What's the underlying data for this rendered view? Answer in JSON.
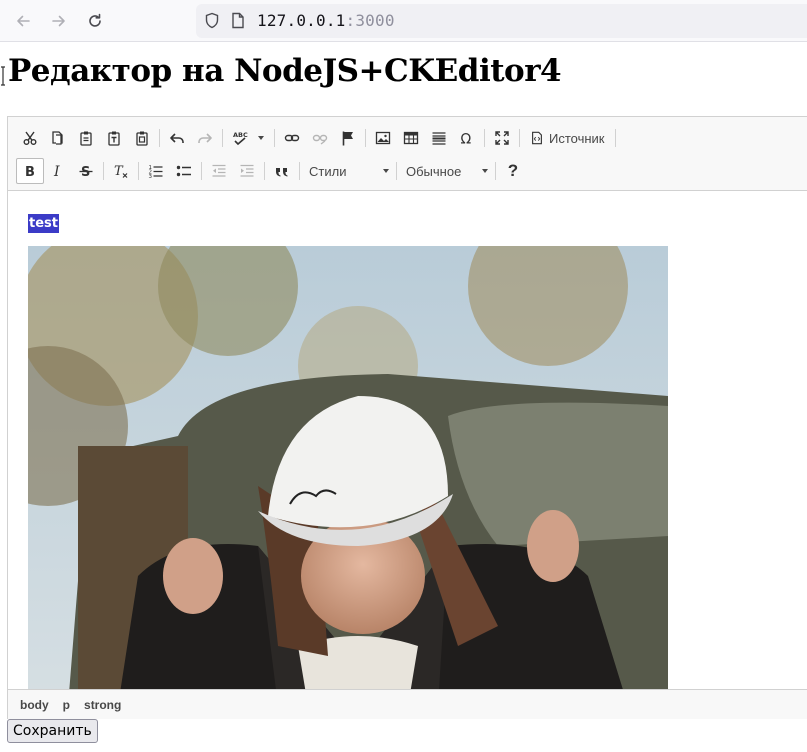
{
  "browser": {
    "url_host": "127.0.0.1",
    "url_port": ":3000"
  },
  "page": {
    "title": "Редактор на NodeJS+CKEditor4"
  },
  "toolbar": {
    "source_label": "Источник",
    "styles_combo": "Стили",
    "format_combo": "Обычное",
    "help_label": "?"
  },
  "content": {
    "selected_text": "test"
  },
  "statusbar": {
    "path": [
      "body",
      "p",
      "strong"
    ]
  },
  "form": {
    "save_label": "Сохранить"
  },
  "colors": {
    "selection": "#3b3bc7",
    "toolbar_bg": "#f8f8f8",
    "border": "#d1d1d1"
  },
  "icons": [
    "back-icon",
    "forward-icon",
    "reload-icon",
    "shield-icon",
    "page-icon",
    "cut-icon",
    "copy-icon",
    "paste-icon",
    "paste-text-icon",
    "paste-word-icon",
    "undo-icon",
    "redo-icon",
    "spellcheck-icon",
    "link-icon",
    "unlink-icon",
    "anchor-icon",
    "image-icon",
    "table-icon",
    "horizontal-line-icon",
    "special-char-icon",
    "maximize-icon",
    "source-icon",
    "bold-icon",
    "italic-icon",
    "strike-icon",
    "remove-format-icon",
    "numbered-list-icon",
    "bulleted-list-icon",
    "outdent-icon",
    "indent-icon",
    "blockquote-icon"
  ]
}
